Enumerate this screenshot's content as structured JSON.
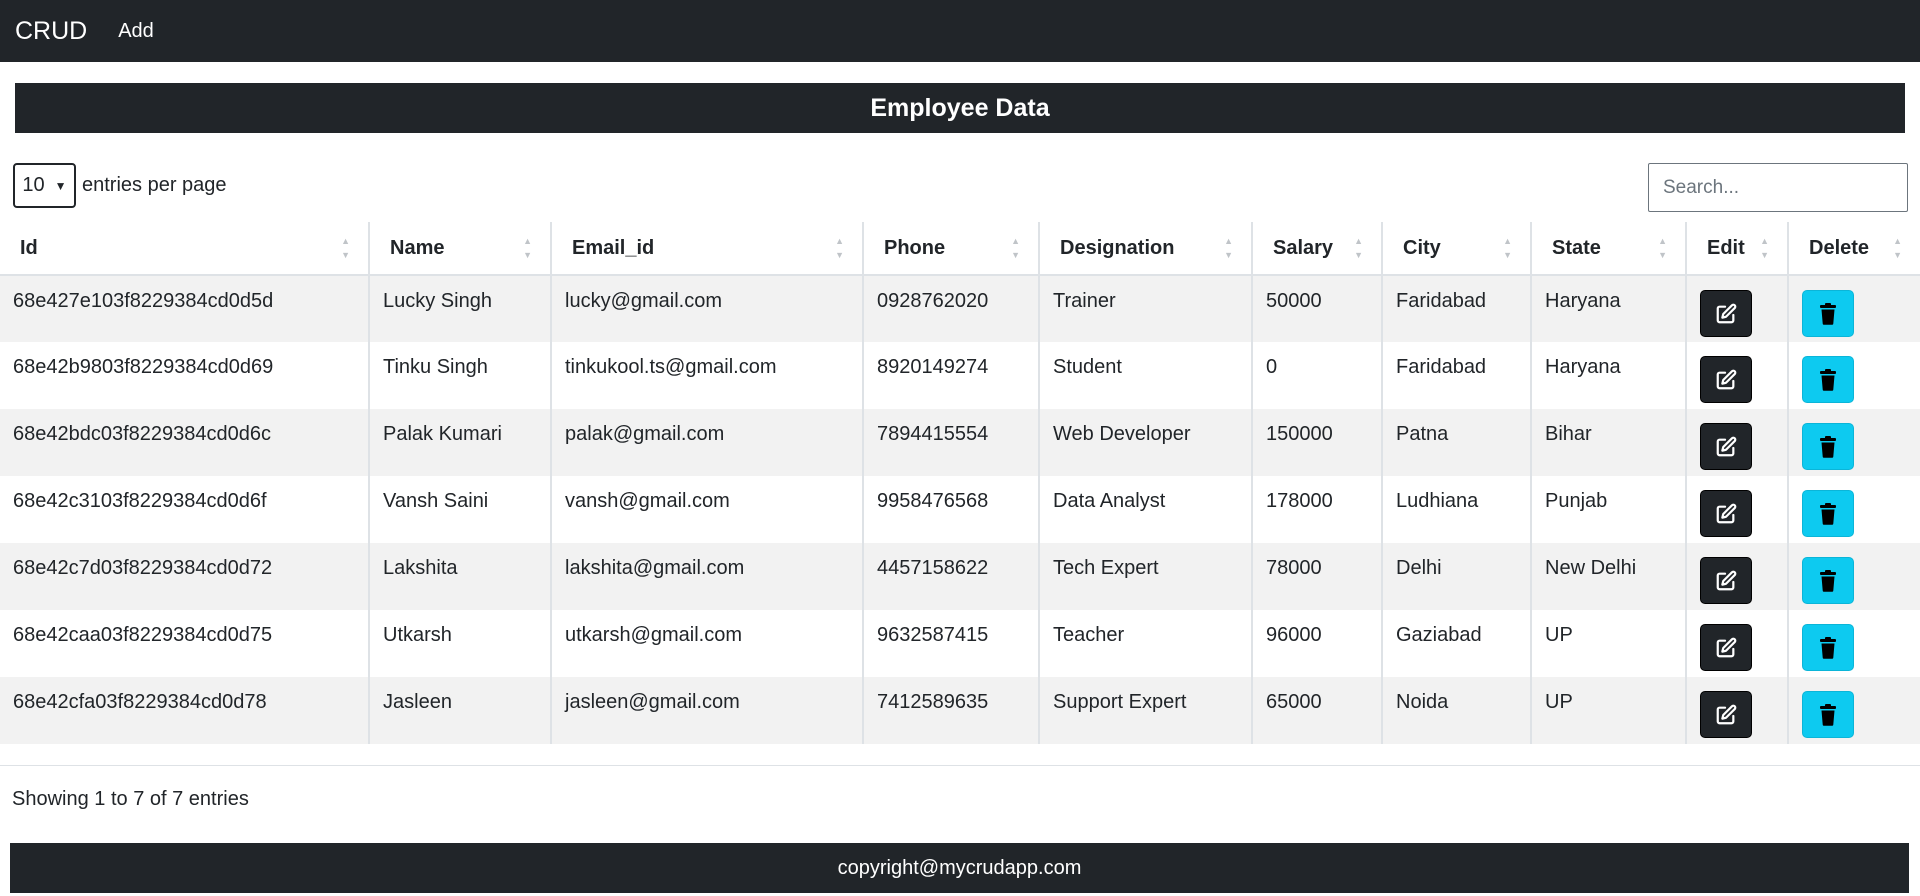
{
  "navbar": {
    "brand": "CRUD",
    "add_link": "Add"
  },
  "title": "Employee Data",
  "controls": {
    "per_page_value": "10",
    "per_page_label": "entries per page",
    "search_placeholder": "Search..."
  },
  "table": {
    "headers": [
      "Id",
      "Name",
      "Email_id",
      "Phone",
      "Designation",
      "Salary",
      "City",
      "State",
      "Edit",
      "Delete"
    ],
    "rows": [
      [
        "68e427e103f8229384cd0d5d",
        "Lucky Singh",
        "lucky@gmail.com",
        "0928762020",
        "Trainer",
        "50000",
        "Faridabad",
        "Haryana"
      ],
      [
        "68e42b9803f8229384cd0d69",
        "Tinku Singh",
        "tinkukool.ts@gmail.com",
        "8920149274",
        "Student",
        "0",
        "Faridabad",
        "Haryana"
      ],
      [
        "68e42bdc03f8229384cd0d6c",
        "Palak Kumari",
        "palak@gmail.com",
        "7894415554",
        "Web Developer",
        "150000",
        "Patna",
        "Bihar"
      ],
      [
        "68e42c3103f8229384cd0d6f",
        "Vansh Saini",
        "vansh@gmail.com",
        "9958476568",
        "Data Analyst",
        "178000",
        "Ludhiana",
        "Punjab"
      ],
      [
        "68e42c7d03f8229384cd0d72",
        "Lakshita",
        "lakshita@gmail.com",
        "4457158622",
        "Tech Expert",
        "78000",
        "Delhi",
        "New Delhi"
      ],
      [
        "68e42caa03f8229384cd0d75",
        "Utkarsh",
        "utkarsh@gmail.com",
        "9632587415",
        "Teacher",
        "96000",
        "Gaziabad",
        "UP"
      ],
      [
        "68e42cfa03f8229384cd0d78",
        "Jasleen",
        "jasleen@gmail.com",
        "7412589635",
        "Support Expert",
        "65000",
        "Noida",
        "UP"
      ]
    ]
  },
  "icons": {
    "edit": "edit-icon",
    "delete": "trash-icon",
    "sort": "sort-icon"
  },
  "colors": {
    "dark": "#212529",
    "info": "#0dcaf0",
    "stripe": "#f2f2f2"
  },
  "info_text": "Showing 1 to 7 of 7 entries",
  "footer": "copyright@mycrudapp.com"
}
